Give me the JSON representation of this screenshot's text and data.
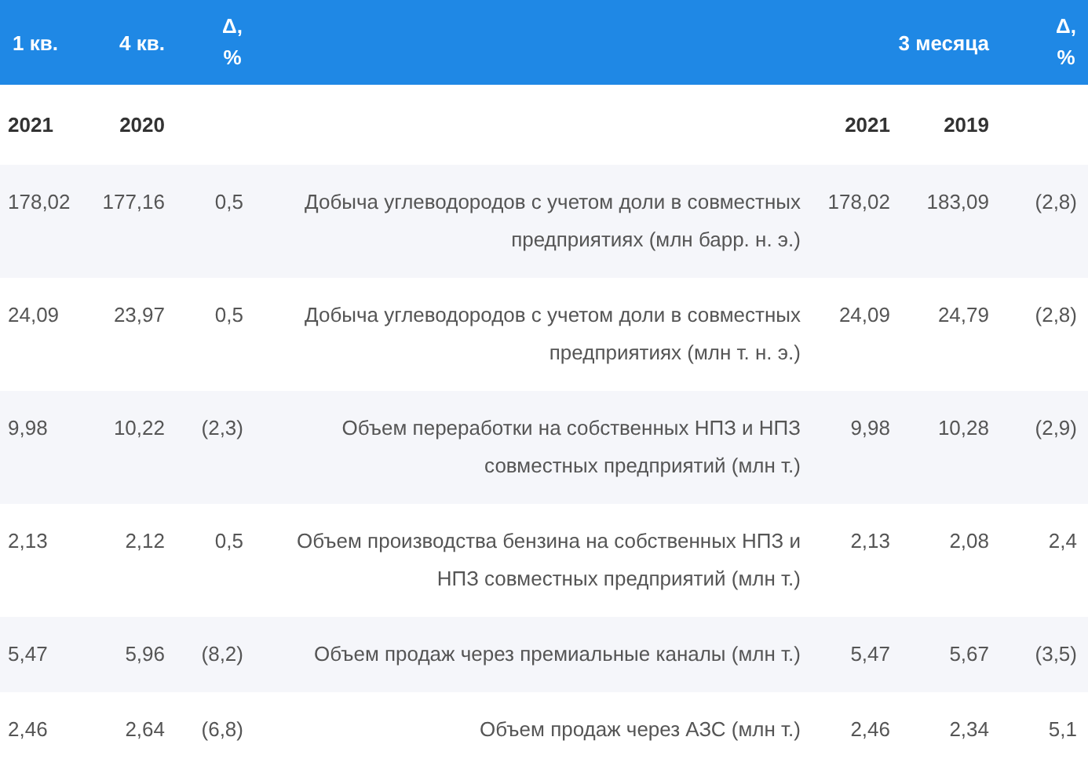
{
  "header": {
    "q1": "1 кв.",
    "q4": "4 кв.",
    "delta_q": "Δ, %",
    "months": "3 месяца",
    "delta_m": "Δ, %"
  },
  "years": {
    "q1": "2021",
    "q4": "2020",
    "m_current": "2021",
    "m_prior": "2019"
  },
  "rows": [
    {
      "q1": "178,02",
      "q4": "177,16",
      "delta_q": "0,5",
      "indicator": "Добыча углеводородов с учетом доли в совместных предприятиях (млн барр. н. э.)",
      "m_current": "178,02",
      "m_prior": "183,09",
      "delta_m": "(2,8)"
    },
    {
      "q1": "24,09",
      "q4": "23,97",
      "delta_q": "0,5",
      "indicator": "Добыча углеводородов с учетом доли в совместных предприятиях (млн т. н. э.)",
      "m_current": "24,09",
      "m_prior": "24,79",
      "delta_m": "(2,8)"
    },
    {
      "q1": "9,98",
      "q4": "10,22",
      "delta_q": "(2,3)",
      "indicator": "Объем переработки на собственных НПЗ и НПЗ совместных предприятий (млн т.)",
      "m_current": "9,98",
      "m_prior": "10,28",
      "delta_m": "(2,9)"
    },
    {
      "q1": "2,13",
      "q4": "2,12",
      "delta_q": "0,5",
      "indicator": "Объем производства бензина на собственных НПЗ и НПЗ совместных предприятий (млн т.)",
      "m_current": "2,13",
      "m_prior": "2,08",
      "delta_m": "2,4"
    },
    {
      "q1": "5,47",
      "q4": "5,96",
      "delta_q": "(8,2)",
      "indicator": "Объем продаж через премиальные каналы (млн т.)",
      "m_current": "5,47",
      "m_prior": "5,67",
      "delta_m": "(3,5)"
    },
    {
      "q1": "2,46",
      "q4": "2,64",
      "delta_q": "(6,8)",
      "indicator": "Объем продаж через АЗС (млн т.)",
      "m_current": "2,46",
      "m_prior": "2,34",
      "delta_m": "5,1"
    }
  ]
}
